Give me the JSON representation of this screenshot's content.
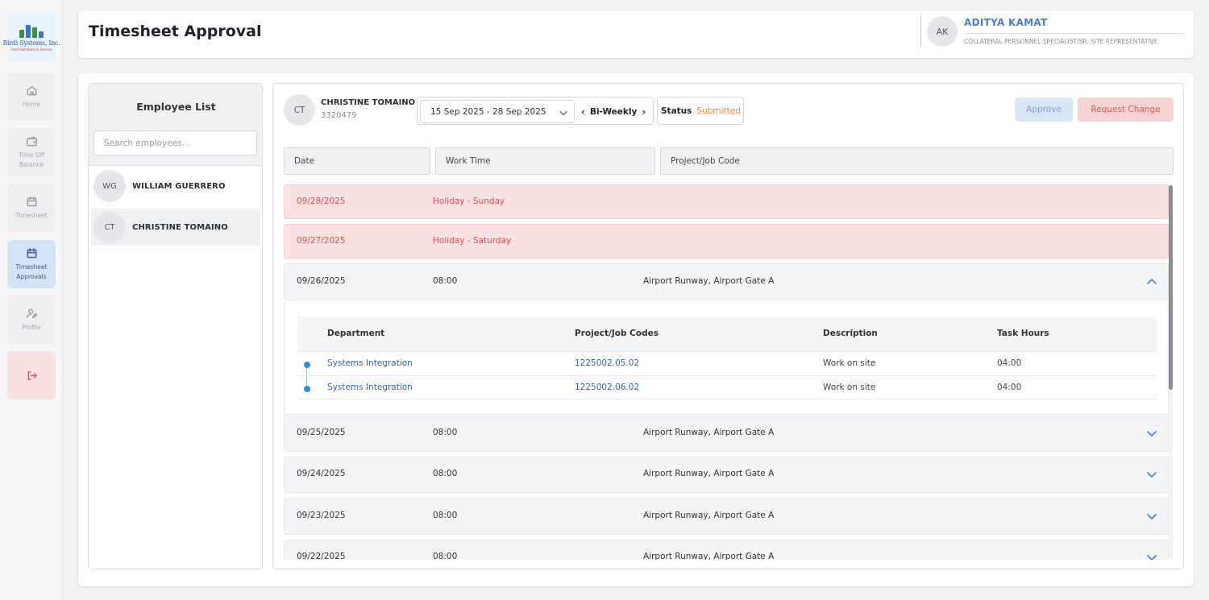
{
  "brand": {
    "name": "Birdi Systems, Inc.",
    "tagline": "Fresh Solutions in Service"
  },
  "sidebar": {
    "items": [
      {
        "label": "Home",
        "icon": "home-icon"
      },
      {
        "label": "Time Off Balance",
        "icon": "wallet-icon"
      },
      {
        "label": "Timesheet",
        "icon": "calendar-icon"
      },
      {
        "label": "Timesheet Approvals",
        "icon": "calendar-icon",
        "active": true
      },
      {
        "label": "Profile",
        "icon": "user-edit-icon"
      },
      {
        "label": "",
        "icon": "logout-icon"
      }
    ]
  },
  "header": {
    "title": "Timesheet Approval",
    "user": {
      "initials": "AK",
      "name": "ADITYA KAMAT",
      "role": "COLLATERAL PERSONNEL SPECIALIST/SR. SITE REPRESENTATIVE"
    }
  },
  "employee_list": {
    "title": "Employee List",
    "search_placeholder": "Search employees...",
    "employees": [
      {
        "initials": "WG",
        "name": "WILLIAM GUERRERO",
        "selected": false
      },
      {
        "initials": "CT",
        "name": "CHRISTINE TOMAINO",
        "selected": true
      }
    ]
  },
  "timesheet": {
    "employee": {
      "initials": "CT",
      "name": "CHRISTINE TOMAINO",
      "id": "3320479"
    },
    "period": "15 Sep 2025 - 28 Sep 2025",
    "frequency": "Bi-Weekly",
    "status_label": "Status",
    "status_value": "Submitted",
    "approve_label": "Approve",
    "request_change_label": "Request Change",
    "columns": [
      "Date",
      "Work Time",
      "Project/Job Code"
    ],
    "rows": [
      {
        "date": "09/28/2025",
        "work_time": "Holiday - Sunday",
        "project": "",
        "type": "holiday"
      },
      {
        "date": "09/27/2025",
        "work_time": "Holiday - Saturday",
        "project": "",
        "type": "holiday"
      },
      {
        "date": "09/26/2025",
        "work_time": "08:00",
        "project": "Airport Runway, Airport Gate A",
        "type": "expanded"
      },
      {
        "date": "09/25/2025",
        "work_time": "08:00",
        "project": "Airport Runway, Airport Gate A",
        "type": "normal"
      },
      {
        "date": "09/24/2025",
        "work_time": "08:00",
        "project": "Airport Runway, Airport Gate A",
        "type": "normal"
      },
      {
        "date": "09/23/2025",
        "work_time": "08:00",
        "project": "Airport Runway, Airport Gate A",
        "type": "normal"
      },
      {
        "date": "09/22/2025",
        "work_time": "08:00",
        "project": "Airport Runway, Airport Gate A",
        "type": "normal"
      }
    ],
    "detail": {
      "columns": [
        "Department",
        "Project/Job Codes",
        "Description",
        "Task Hours"
      ],
      "entries": [
        {
          "department": "Systems Integration",
          "code": "1225002.05.02",
          "description": "Work on site",
          "hours": "04:00"
        },
        {
          "department": "Systems Integration",
          "code": "1225002.06.02",
          "description": "Work on site",
          "hours": "04:00"
        }
      ]
    }
  },
  "colors": {
    "accent": "#4a7fd0",
    "holiday_bg": "#fbe2e2",
    "holiday_text": "#dc4b4b",
    "status_submitted": "#e8862f",
    "approve_bg": "#d8e6f6",
    "request_bg": "#f8d3d3"
  }
}
